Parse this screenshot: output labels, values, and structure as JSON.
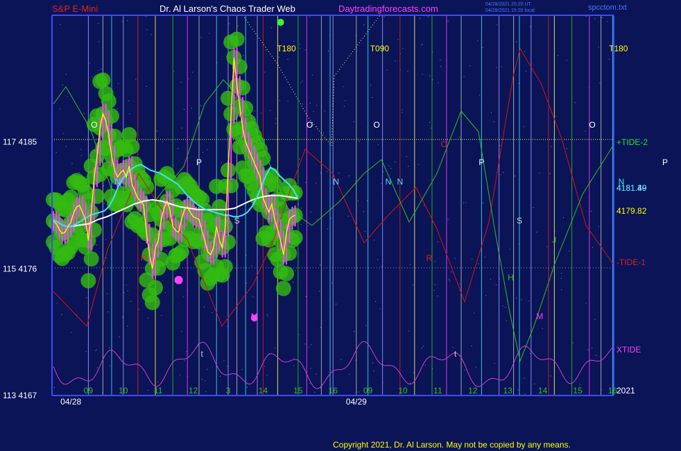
{
  "header": {
    "symbol": "S&P E-Mini",
    "title": "Dr. Al Larson's Chaos Trader Web",
    "site": "Daytradingforecasts.com",
    "timestamp_ut": "04/28/2021 20:20 UT",
    "timestamp_local": "04/28/2021 15:20 local",
    "file": "spcctom.txt"
  },
  "footer": {
    "copyright": "Copyright 2021, Dr. Al Larson. May not be copied by any means."
  },
  "colors": {
    "background": "#0a1457",
    "axis": "#3f49ff",
    "price_line": "#ffff00",
    "price_bar": "#ff40ff",
    "cyan_avg": "#40e0ff",
    "white_avg": "#ffffff",
    "green_glow": "#33bb10",
    "tide1": "#e01010",
    "tide2": "#30c020",
    "xtide": "#d040d0"
  },
  "chart_data": {
    "type": "line",
    "title": "S&P E-Mini",
    "y_left_labels": [
      {
        "text": "117  4185",
        "value": 4185
      },
      {
        "text": "115  4176",
        "value": 4176
      },
      {
        "text": "113  4167",
        "value": 4167
      }
    ],
    "ylim": [
      4167,
      4194
    ],
    "x_ticks": [
      {
        "label": "09",
        "bar": 12
      },
      {
        "label": "10",
        "bar": 24
      },
      {
        "label": "11",
        "bar": 36
      },
      {
        "label": "12",
        "bar": 48
      },
      {
        "label": "3",
        "bar": 60
      },
      {
        "label": "14",
        "bar": 72
      },
      {
        "label": "15",
        "bar": 84
      },
      {
        "label": "16",
        "bar": 96
      },
      {
        "label": "09",
        "bar": 108
      },
      {
        "label": "10",
        "bar": 120
      },
      {
        "label": "11",
        "bar": 132
      },
      {
        "label": "12",
        "bar": 144
      },
      {
        "label": "13",
        "bar": 156
      },
      {
        "label": "14",
        "bar": 168
      },
      {
        "label": "15",
        "bar": 180
      },
      {
        "label": "16",
        "bar": 192
      }
    ],
    "date_labels": [
      {
        "text": "04/28",
        "bar": 6
      },
      {
        "text": "04/29",
        "bar": 104
      }
    ],
    "year_label": "2021",
    "price_series": {
      "name": "S&P E-Mini",
      "close": [
        4179.4,
        4179.2,
        4178.8,
        4178.5,
        4178.6,
        4179.0,
        4179.3,
        4180.0,
        4180.4,
        4180.5,
        4180.0,
        4179.5,
        4178.0,
        4180.0,
        4182.5,
        4184.0,
        4186.0,
        4187.0,
        4186.5,
        4185.5,
        4184.0,
        4183.0,
        4182.5,
        4182.8,
        4183.0,
        4182.5,
        4183.3,
        4182.0,
        4181.5,
        4181.0,
        4180.8,
        4180.5,
        4178.5,
        4177.0,
        4176.0,
        4177.5,
        4178.0,
        4179.5,
        4180.3,
        4180.8,
        4180.2,
        4179.0,
        4178.7,
        4178.6,
        4179.5,
        4180.2,
        4180.4,
        4180.0,
        4179.7,
        4179.6,
        4179.5,
        4178.7,
        4178.0,
        4177.2,
        4177.0,
        4177.5,
        4179.0,
        4178.0,
        4177.5,
        4179.0,
        4183.0,
        4187.0,
        4191.0,
        4189.0,
        4187.5,
        4186.0,
        4185.0,
        4184.5,
        4184.0,
        4183.5,
        4183.0,
        4182.5,
        4181.0,
        4180.5,
        4180.0,
        4180.6,
        4179.5,
        4178.8,
        4178.0,
        4177.0,
        4178.5,
        4179.5,
        4179.7,
        4179.8
      ],
      "high_point": 4193.5,
      "low_point": 4172.5
    },
    "cyan_average": [
      4179.5,
      4179.3,
      4179.1,
      4179.0,
      4179.0,
      4179.2,
      4179.4,
      4179.6,
      4179.8,
      4179.9,
      4180.0,
      4180.1,
      4180.4,
      4181.0,
      4181.8,
      4182.4,
      4182.8,
      4183.1,
      4183.3,
      4183.4,
      4183.2,
      4183.0,
      4182.9,
      4182.8,
      4182.6,
      4182.4,
      4182.2,
      4182.0,
      4181.6,
      4181.2,
      4180.9,
      4180.6,
      4180.4,
      4180.2,
      4180.1,
      4180.0,
      4179.9,
      4179.8,
      4179.8,
      4179.7,
      4179.7,
      4179.8,
      4180.0,
      4180.4,
      4181.0,
      4181.8,
      4182.6,
      4183.2,
      4183.0,
      4182.6,
      4182.3,
      4182.0,
      4181.6,
      4181.0
    ],
    "white_average": [
      4179.0,
      4179.1,
      4179.2,
      4179.5,
      4179.7,
      4180.0,
      4180.3,
      4180.6,
      4180.8,
      4180.9,
      4180.8,
      4180.6,
      4180.4,
      4180.3,
      4180.2,
      4180.2,
      4180.2,
      4180.2,
      4180.3,
      4180.6,
      4180.9,
      4181.1,
      4181.2,
      4181.2,
      4181.1,
      4181.0
    ],
    "series": [
      {
        "name": "+TIDE-2",
        "value": 4185.0
      },
      {
        "name": "-TIDE-1",
        "value": 4175.5
      },
      {
        "name": "XTIDE"
      }
    ],
    "right_values": [
      "4181.49",
      "4181.30",
      "4179.82"
    ],
    "markers": [
      {
        "text": "T180",
        "bar": 80
      },
      {
        "text": "T090",
        "bar": 112
      },
      {
        "text": "T180",
        "bar": 194
      },
      {
        "text": "O",
        "bar": 14
      },
      {
        "text": "O",
        "bar": 88
      },
      {
        "text": "O",
        "bar": 111
      },
      {
        "text": "O",
        "bar": 185
      },
      {
        "text": "P",
        "bar": 50
      },
      {
        "text": "P",
        "bar": 147
      },
      {
        "text": "P",
        "bar": 210
      },
      {
        "text": "N",
        "bar": 22
      },
      {
        "text": "N",
        "bar": 97
      },
      {
        "text": "N",
        "bar": 115
      },
      {
        "text": "N",
        "bar": 119
      },
      {
        "text": "N",
        "bar": 195
      },
      {
        "text": "R",
        "bar": 31
      },
      {
        "text": "R",
        "bar": 129
      },
      {
        "text": "C",
        "bar": 134
      },
      {
        "text": "S",
        "bar": 63
      },
      {
        "text": "S",
        "bar": 160
      },
      {
        "text": "H",
        "bar": 59
      },
      {
        "text": "H",
        "bar": 157
      },
      {
        "text": "M",
        "bar": 69
      },
      {
        "text": "M",
        "bar": 167
      },
      {
        "text": "J",
        "bar": 172
      },
      {
        "text": "t",
        "bar": 51
      },
      {
        "text": "t",
        "bar": 138
      }
    ]
  }
}
